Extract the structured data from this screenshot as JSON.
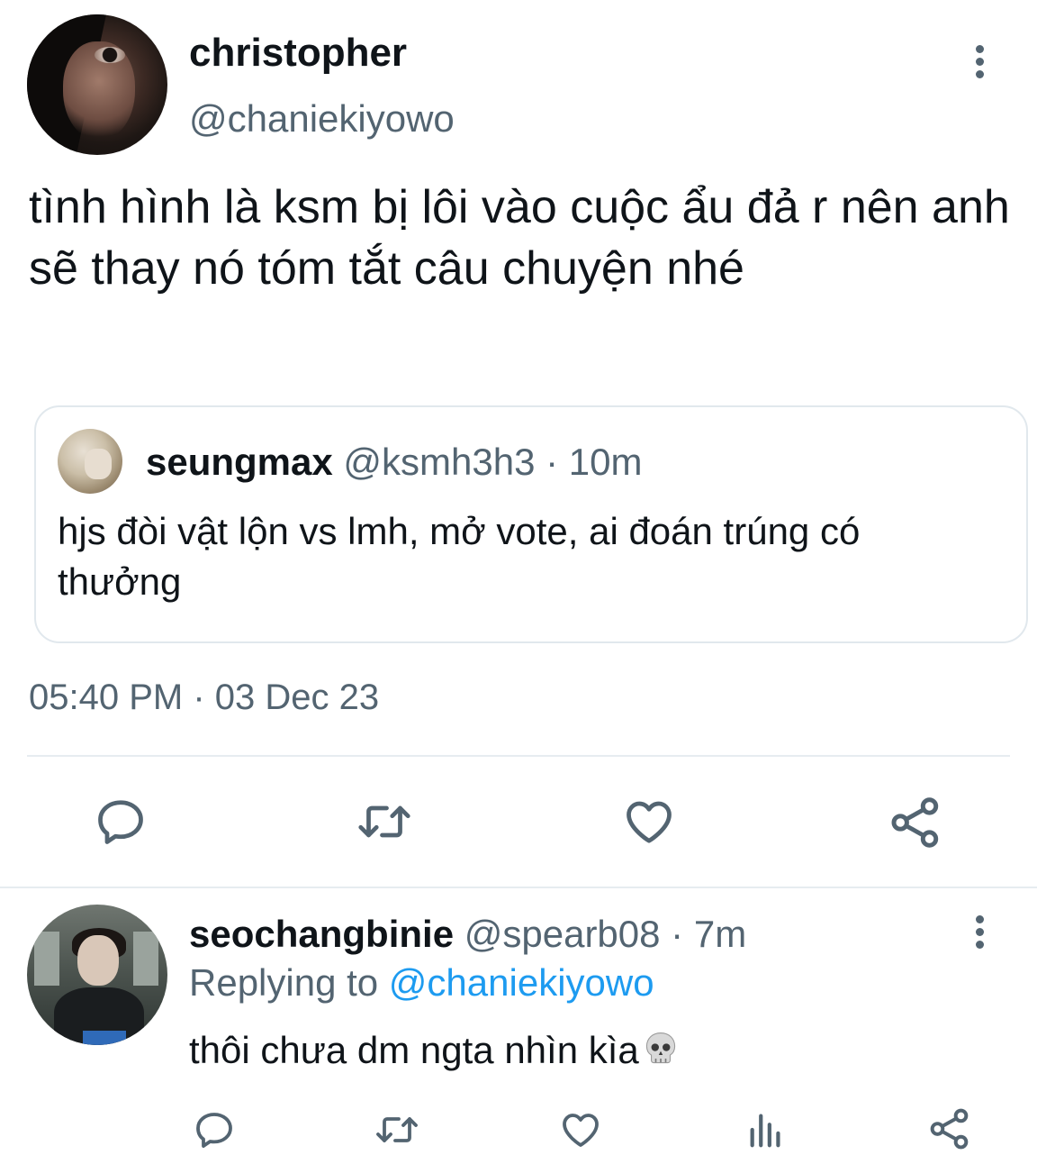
{
  "main_tweet": {
    "display_name": "christopher",
    "handle": "@chaniekiyowo",
    "text": "tình hình là ksm bị lôi vào cuộc ẩu đả r nên anh sẽ thay nó tóm tắt câu chuyện nhé",
    "timestamp": "05:40 PM · 03 Dec 23",
    "quote": {
      "display_name": "seungmax",
      "meta": "@ksmh3h3 · 10m",
      "text": "hjs đòi vật lộn vs lmh, mở vote, ai đoán trúng có thưởng"
    },
    "actions": [
      "reply-icon",
      "retweet-icon",
      "like-icon",
      "share-icon"
    ]
  },
  "reply_tweet": {
    "display_name": "seochangbinie",
    "meta": "@spearb08 · 7m",
    "replying_label": "Replying to",
    "replying_handle": "@chaniekiyowo",
    "text": "thôi chưa dm ngta nhìn kìa",
    "emoji": "skull-icon",
    "actions": [
      "reply-icon",
      "retweet-icon",
      "like-icon",
      "analytics-icon",
      "share-icon"
    ]
  },
  "colors": {
    "text_primary": "#0f1419",
    "text_secondary": "#536471",
    "accent": "#1d9bf0",
    "border": "#e1e8ed"
  }
}
